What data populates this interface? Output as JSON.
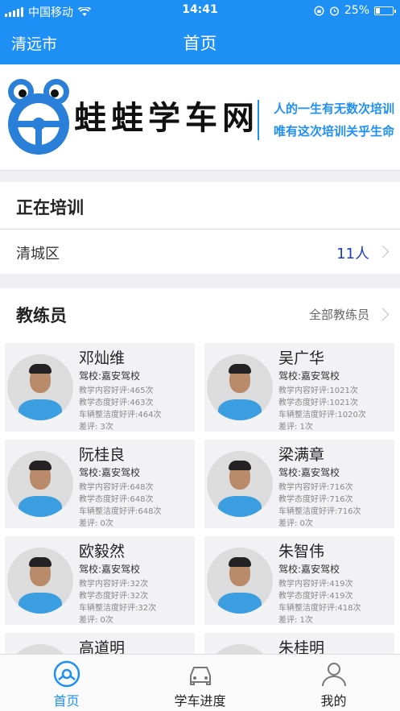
{
  "status_bar": {
    "carrier": "中国移动",
    "time": "14:41",
    "battery": "25%",
    "battery_level": 0.25
  },
  "nav": {
    "city": "清远市",
    "title": "首页"
  },
  "banner": {
    "brand": "蛙蛙学车网",
    "slogan1": "人的一生有无数次培训",
    "slogan2": "唯有这次培训关乎生命"
  },
  "training": {
    "title": "正在培训",
    "district": "清城区",
    "count": "11人"
  },
  "coaches_section": {
    "title": "教练员",
    "all_link": "全部教练员"
  },
  "coaches": [
    {
      "name": "邓灿维",
      "school": "驾校:嘉安驾校",
      "s1": "教学内容好评:465次",
      "s2": "教学态度好评:463次",
      "s3": "车辆整洁度好评:464次",
      "s4": "差评: 3次"
    },
    {
      "name": "吴广华",
      "school": "驾校:嘉安驾校",
      "s1": "教学内容好评:1021次",
      "s2": "教学态度好评:1021次",
      "s3": "车辆整洁度好评:1020次",
      "s4": "差评: 1次"
    },
    {
      "name": "阮桂良",
      "school": "驾校:嘉安驾校",
      "s1": "教学内容好评:648次",
      "s2": "教学态度好评:648次",
      "s3": "车辆整洁度好评:648次",
      "s4": "差评: 0次"
    },
    {
      "name": "梁满章",
      "school": "驾校:嘉安驾校",
      "s1": "教学内容好评:716次",
      "s2": "教学态度好评:716次",
      "s3": "车辆整洁度好评:716次",
      "s4": "差评: 0次"
    },
    {
      "name": "欧毅然",
      "school": "驾校:嘉安驾校",
      "s1": "教学内容好评:32次",
      "s2": "教学态度好评:32次",
      "s3": "车辆整洁度好评:32次",
      "s4": "差评: 0次"
    },
    {
      "name": "朱智伟",
      "school": "驾校:嘉安驾校",
      "s1": "教学内容好评:419次",
      "s2": "教学态度好评:419次",
      "s3": "车辆整洁度好评:418次",
      "s4": "差评: 1次"
    },
    {
      "name": "高道明"
    },
    {
      "name": "朱桂明"
    }
  ],
  "tabs": [
    {
      "label": "首页",
      "icon": "steering-wheel-icon"
    },
    {
      "label": "学车进度",
      "icon": "car-icon"
    },
    {
      "label": "我的",
      "icon": "person-icon"
    }
  ],
  "colors": {
    "accent": "#1e90f5",
    "count_blue": "#1a3cc8",
    "tab_active": "#1e90f5",
    "tab_inactive": "#222222"
  }
}
